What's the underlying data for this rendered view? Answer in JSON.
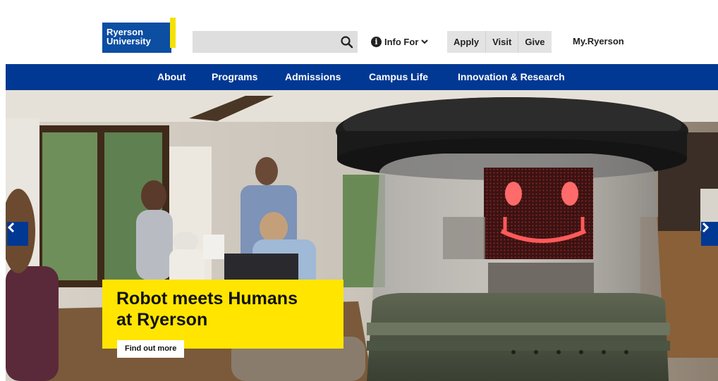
{
  "header": {
    "logo": {
      "line1": "Ryerson",
      "line2": "University"
    },
    "search": {
      "placeholder": "",
      "value": ""
    },
    "info_for": "Info For",
    "quick_links": [
      "Apply",
      "Visit",
      "Give"
    ],
    "my_ryerson": "My.Ryerson"
  },
  "nav": {
    "items": [
      "About",
      "Programs",
      "Admissions",
      "Campus Life",
      "Innovation & Research"
    ]
  },
  "hero": {
    "caption": {
      "line1": "Robot meets Humans",
      "line2": "at Ryerson"
    },
    "cta_label": "Find out more"
  },
  "colors": {
    "brand_blue": "#003893",
    "logo_blue": "#0b4ea2",
    "accent_yellow": "#ffe500"
  },
  "icons": [
    "search-icon",
    "info-icon",
    "chevron-down-icon",
    "chevron-left-icon",
    "chevron-right-icon"
  ]
}
